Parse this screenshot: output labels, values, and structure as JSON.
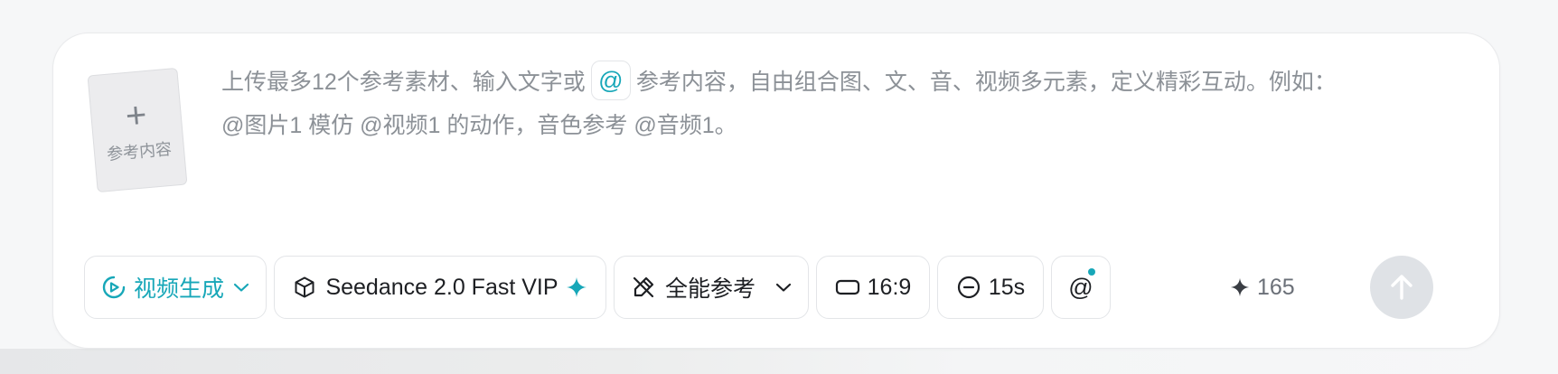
{
  "reference": {
    "plus_glyph": "+",
    "label": "参考内容"
  },
  "prompt": {
    "line1_before_at": "上传最多12个参考素材、输入文字或",
    "at_glyph": "@",
    "line1_after_at": "参考内容，自由组合图、文、音、视频多元素，定义精彩互动。例如：",
    "line2": "@图片1 模仿 @视频1 的动作，音色参考 @音频1。"
  },
  "toolbar": {
    "mode_label": "视频生成",
    "model_label": "Seedance 2.0 Fast VIP",
    "reference_mode_label": "全能参考",
    "aspect_ratio": "16:9",
    "duration": "15s",
    "mention_glyph": "@",
    "credits": "165"
  },
  "colors": {
    "accent": "#17a7b8",
    "send_button": "#dfe2e6",
    "text_primary": "#1d1f23",
    "text_placeholder": "#8c9197"
  },
  "icons": {
    "mode": "play-circle-icon",
    "model": "cube-icon",
    "reference_mode": "crossed-pen-icon",
    "aspect": "rectangle-icon",
    "duration": "minus-circle-icon",
    "credits": "sparkle-icon",
    "send": "arrow-up-icon"
  }
}
